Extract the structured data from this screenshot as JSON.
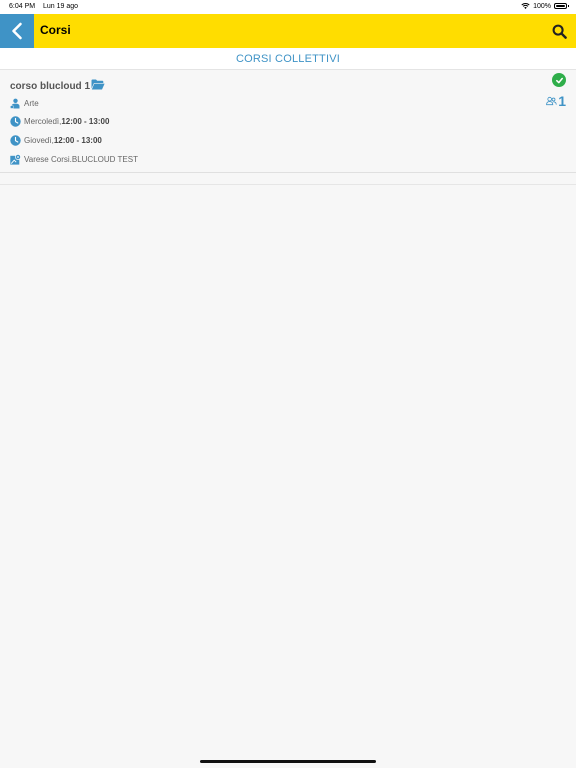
{
  "status_bar": {
    "time": "6:04 PM",
    "date": "Lun 19 ago",
    "battery": "100%"
  },
  "nav": {
    "title": "Corsi",
    "back_icon": "chevron-left-icon",
    "search_icon": "search-icon"
  },
  "section": {
    "title": "CORSI COLLETTIVI"
  },
  "course": {
    "name": "corso blucloud 1",
    "category": "Arte",
    "schedules": [
      {
        "day": "Mercoledì",
        "separator": ", ",
        "time": "12:00 - 13:00"
      },
      {
        "day": "Giovedì",
        "separator": ", ",
        "time": "12:00 - 13:00"
      }
    ],
    "location": "Varese Corsi.BLUCLOUD TEST",
    "participants": "1",
    "status": "confirmed"
  },
  "colors": {
    "brand_yellow": "#ffdd00",
    "brand_blue": "#3f93c6",
    "success_green": "#2fae4a"
  }
}
